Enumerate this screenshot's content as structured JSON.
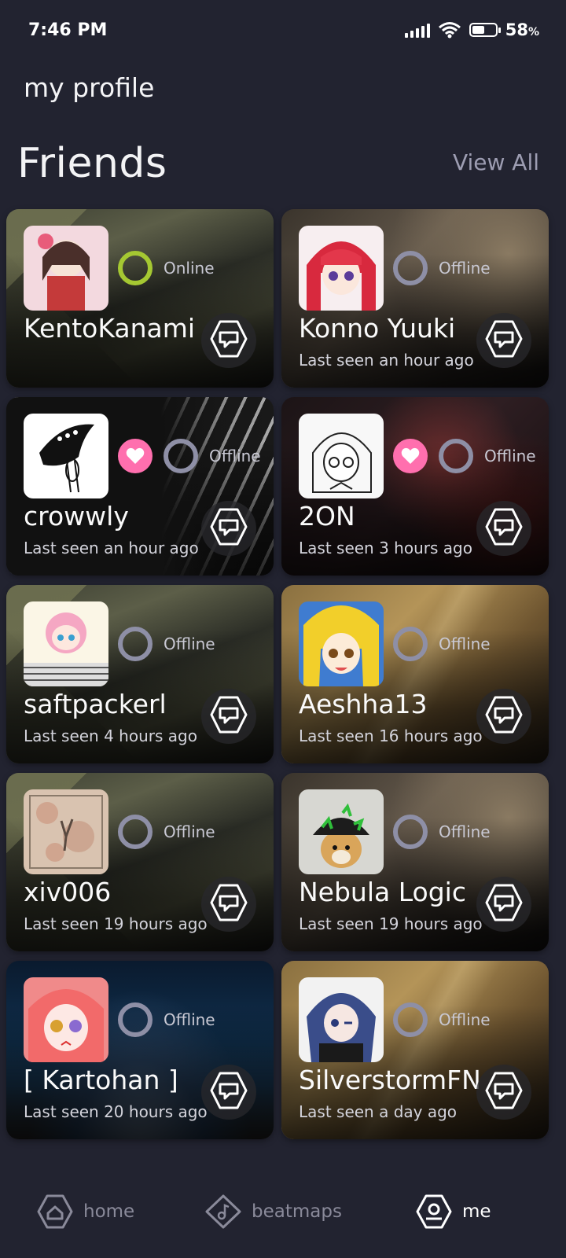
{
  "status_bar": {
    "time": "7:46 PM",
    "battery": "58",
    "battery_unit": "%"
  },
  "header": {
    "title": "my profile"
  },
  "friends_section": {
    "title": "Friends",
    "view_all": "View All"
  },
  "friends": [
    {
      "name": "KentoKanami",
      "status": "Online",
      "last_seen": "",
      "favorite": false,
      "bg": "poly",
      "avatar": "anime-girl-pink"
    },
    {
      "name": "Konno Yuuki",
      "status": "Offline",
      "last_seen": "Last seen an hour ago",
      "favorite": false,
      "bg": "brownblur",
      "avatar": "anime-girl-red-hair"
    },
    {
      "name": "crowwly",
      "status": "Offline",
      "last_seen": "Last seen an hour ago",
      "favorite": true,
      "bg": "dark",
      "avatar": "crow-drawing"
    },
    {
      "name": "2ON",
      "status": "Offline",
      "last_seen": "Last seen 3 hours ago",
      "favorite": true,
      "bg": "darkred",
      "avatar": "manga-sketch"
    },
    {
      "name": "saftpackerl",
      "status": "Offline",
      "last_seen": "Last seen 4 hours ago",
      "favorite": false,
      "bg": "poly",
      "avatar": "pink-hair-chibi"
    },
    {
      "name": "Aeshha13",
      "status": "Offline",
      "last_seen": "Last seen 16 hours ago",
      "favorite": false,
      "bg": "gold",
      "avatar": "blonde-anime-girl"
    },
    {
      "name": "xiv006",
      "status": "Offline",
      "last_seen": "Last seen 19 hours ago",
      "favorite": false,
      "bg": "poly",
      "avatar": "paper-texture"
    },
    {
      "name": "Nebula Logic",
      "status": "Offline",
      "last_seen": "Last seen 19 hours ago",
      "favorite": false,
      "bg": "brownblur",
      "avatar": "dog-with-hat"
    },
    {
      "name": "[ Kartohan ]",
      "status": "Offline",
      "last_seen": "Last seen 20 hours ago",
      "favorite": false,
      "bg": "forest",
      "avatar": "anime-girl-red"
    },
    {
      "name": "SilverstormFN",
      "status": "Offline",
      "last_seen": "Last seen a day ago",
      "favorite": false,
      "bg": "gold",
      "avatar": "blue-hair-anime"
    }
  ],
  "bottom_nav": {
    "home": "home",
    "beatmaps": "beatmaps",
    "me": "me"
  },
  "colors": {
    "background": "#222330",
    "online": "#a5c832",
    "offline": "#8e8fa6",
    "favorite": "#ff6fae"
  }
}
